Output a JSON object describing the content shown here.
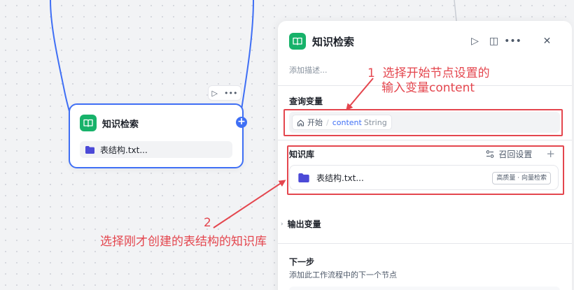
{
  "colors": {
    "accent": "#3f6ff5",
    "kb_green": "#17b26a",
    "annotation_red": "#e4464e"
  },
  "node": {
    "title": "知识检索",
    "file_label": "表结构.txt...",
    "toolbar": {
      "run_icon": "▷",
      "more_icon": "•••"
    },
    "icon": "book-icon",
    "add_icon": "+"
  },
  "panel": {
    "title": "知识检索",
    "description_placeholder": "添加描述...",
    "actions": {
      "run_icon": "▷",
      "split_icon": "◫",
      "more_icon": "•••",
      "close_icon": "✕"
    },
    "query_section": {
      "label": "查询变量",
      "variable": {
        "source": "开始",
        "separator": "/",
        "name": "content",
        "type": "String"
      }
    },
    "kb_section": {
      "label": "知识库",
      "settings_label": "召回设置",
      "add_icon": "+",
      "item": {
        "name": "表结构.txt...",
        "badge": "高质量 · 向量检索"
      }
    },
    "output_section": {
      "label": "输出变量",
      "chevron": "›"
    },
    "next_section": {
      "label": "下一步",
      "description": "添加此工作流程中的下一个节点"
    }
  },
  "annotations": {
    "note1_number": "1",
    "note1_line1": "选择开始节点设置的",
    "note1_line2": "输入变量content",
    "note2_number": "2",
    "note2_text": "选择刚才创建的表结构的知识库"
  }
}
